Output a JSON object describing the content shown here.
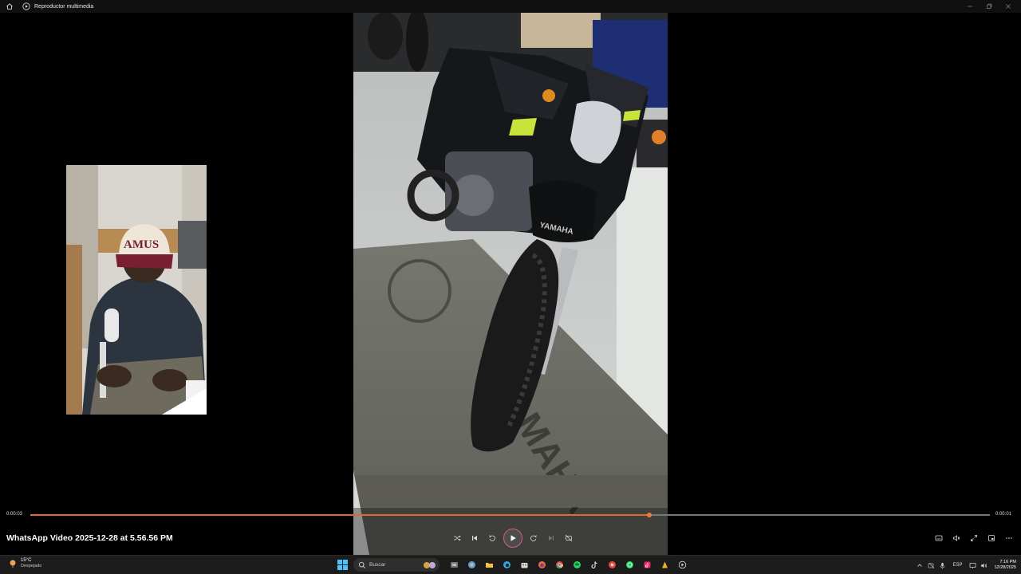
{
  "window": {
    "title": "Reproductor multimedia"
  },
  "player": {
    "media_title": "WhatsApp Video 2025-12-28 at 5.56.56 PM",
    "elapsed": "0:00:03",
    "remaining": "0:00:01",
    "progress": 0.645
  },
  "taskbar": {
    "weather_temp": "15°C",
    "weather_condition": "Despejado",
    "search_placeholder": "Buscar",
    "language": "ESP",
    "time": "7:16 PM",
    "date": "12/28/2025"
  },
  "colors": {
    "accent": "#e06a2a",
    "play_ring": "#e0559a"
  }
}
